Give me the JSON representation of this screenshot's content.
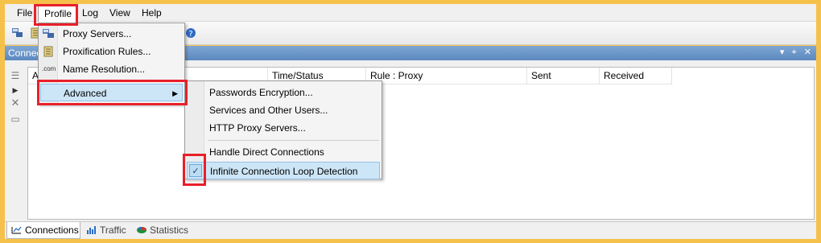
{
  "menubar": {
    "items": [
      "File",
      "Profile",
      "Log",
      "View",
      "Help"
    ]
  },
  "panel": {
    "title": "Connec",
    "controls": [
      "▾",
      "⌖",
      "✕"
    ]
  },
  "columns": [
    "A",
    "Time/Status",
    "Rule : Proxy",
    "Sent",
    "Received"
  ],
  "profile_menu": {
    "items": [
      {
        "label": "Proxy Servers...",
        "icon": "proxy-servers-icon"
      },
      {
        "label": "Proxification Rules...",
        "icon": "rules-icon"
      },
      {
        "label": "Name Resolution...",
        "icon": "dns-icon",
        "icon_text": ".com"
      },
      {
        "label": "Advanced",
        "icon": "none",
        "has_submenu": true
      }
    ]
  },
  "advanced_menu": {
    "items": [
      {
        "label": "Passwords Encryption..."
      },
      {
        "label": "Services and Other Users..."
      },
      {
        "label": "HTTP Proxy Servers..."
      },
      {
        "label": "Handle Direct Connections"
      },
      {
        "label": "Infinite Connection Loop Detection",
        "checked": true
      }
    ]
  },
  "bottom_tabs": [
    {
      "label": "Connections",
      "icon": "connections-icon",
      "active": true
    },
    {
      "label": "Traffic",
      "icon": "traffic-icon",
      "active": false
    },
    {
      "label": "Statistics",
      "icon": "statistics-icon",
      "active": false
    }
  ],
  "colors": {
    "highlight": "#cde6f7",
    "highlight_border": "#3399ff",
    "annotation": "#e8202a",
    "window_border": "#f6c14a"
  }
}
